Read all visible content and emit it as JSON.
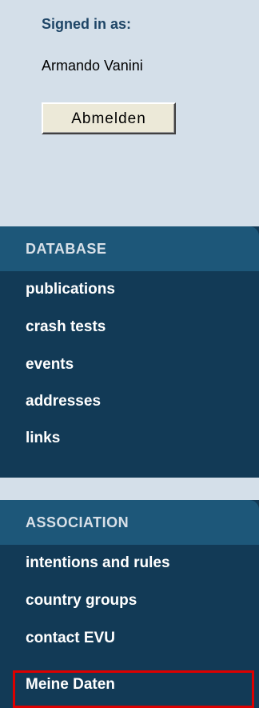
{
  "signin": {
    "label": "Signed in as:",
    "user": "Armando Vanini",
    "logout_button": "Abmelden"
  },
  "database": {
    "title": "DATABASE",
    "items": [
      {
        "label": "publications"
      },
      {
        "label": "crash tests"
      },
      {
        "label": "events"
      },
      {
        "label": "addresses"
      },
      {
        "label": "links"
      }
    ]
  },
  "association": {
    "title": "ASSOCIATION",
    "items": [
      {
        "label": "intentions and rules"
      },
      {
        "label": "country groups"
      },
      {
        "label": "contact EVU"
      },
      {
        "label": "Meine Daten",
        "highlighted": true
      }
    ]
  },
  "colors": {
    "background": "#d4dfe9",
    "panel": "#123a56",
    "panel_header": "#1d5779",
    "signin_label": "#1e4566",
    "highlight": "#dd0000"
  }
}
